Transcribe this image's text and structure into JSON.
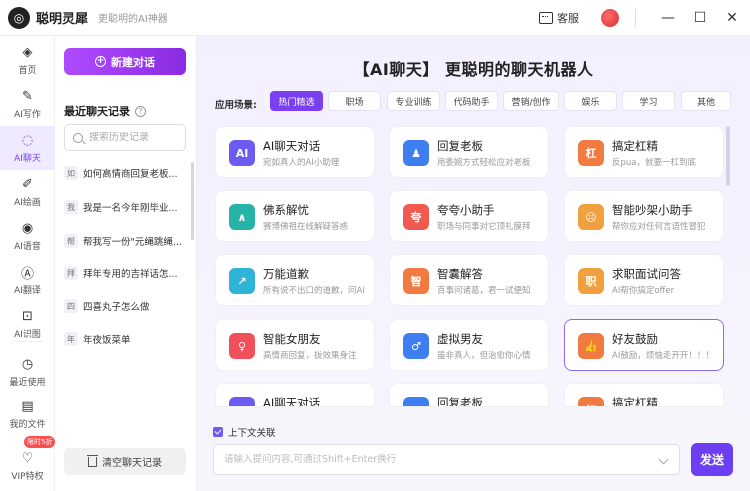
{
  "titlebar": {
    "logo_glyph": "◎",
    "app_name": "聪明灵犀",
    "slogan": "更聪明的AI神器",
    "service_label": "客服",
    "window": {
      "minimize": "—",
      "maximize": "☐",
      "close": "✕"
    }
  },
  "rail": {
    "items": [
      {
        "label": "首页",
        "icon": "◈"
      },
      {
        "label": "AI写作",
        "icon": "✎"
      },
      {
        "label": "AI聊天",
        "icon": "◌"
      },
      {
        "label": "AI绘画",
        "icon": "✐"
      },
      {
        "label": "AI语音",
        "icon": "◉"
      },
      {
        "label": "AI翻译",
        "icon": "Ⓐ"
      },
      {
        "label": "AI识图",
        "icon": "⊡"
      },
      {
        "label": "最近使用",
        "icon": "◷"
      },
      {
        "label": "我的文件",
        "icon": "▤"
      },
      {
        "label": "VIP特权",
        "icon": "♡"
      }
    ],
    "vip_badge": "限时5折"
  },
  "history": {
    "new_chat_label": "新建对话",
    "recent_title": "最近聊天记录",
    "search_placeholder": "搜索历史记录",
    "items": [
      {
        "tag": "如",
        "text": "如何高情商回复老板..."
      },
      {
        "tag": "我",
        "text": "我是一名今年刚毕业..."
      },
      {
        "tag": "帮",
        "text": "帮我写一份\"元绳跳绳..."
      },
      {
        "tag": "拜",
        "text": "拜年专用的吉祥话怎..."
      },
      {
        "tag": "四",
        "text": "四喜丸子怎么做"
      },
      {
        "tag": "年",
        "text": "年夜饭菜单"
      }
    ],
    "clear_label": "清空聊天记录"
  },
  "main": {
    "headline": "【AI聊天】 更聪明的聊天机器人",
    "scene_label": "应用场景:",
    "scenes": [
      "热门精选",
      "职场",
      "专业训练",
      "代码助手",
      "营销/创作",
      "娱乐",
      "学习",
      "其他"
    ],
    "cards": [
      {
        "title": "AI聊天对话",
        "desc": "宛如真人的AI小助理",
        "color": "#6b5bf0",
        "glyph": "AI"
      },
      {
        "title": "回复老板",
        "desc": "用委婉方式轻松应对老板",
        "color": "#3f7ef0",
        "glyph": "♟"
      },
      {
        "title": "搞定杠精",
        "desc": "反pua，就要一杠到底",
        "color": "#f07a3f",
        "glyph": "杠"
      },
      {
        "title": "佛系解忧",
        "desc": "赛博佛祖在线解疑答惑",
        "color": "#27b3a6",
        "glyph": "∧"
      },
      {
        "title": "夸夸小助手",
        "desc": "职场与同事对它顶礼膜拜",
        "color": "#f05a4f",
        "glyph": "夸"
      },
      {
        "title": "智能吵架小助手",
        "desc": "帮你应对任何言语性冒犯",
        "color": "#f0a03f",
        "glyph": "☹"
      },
      {
        "title": "万能道歉",
        "desc": "所有说不出口的道歉，问AI",
        "color": "#2fb4d8",
        "glyph": "↗"
      },
      {
        "title": "智囊解答",
        "desc": "百事问诸葛，君一试便知",
        "color": "#f07a3f",
        "glyph": "智"
      },
      {
        "title": "求职面试问答",
        "desc": "AI帮你搞定offer",
        "color": "#f0a03f",
        "glyph": "职"
      },
      {
        "title": "智能女朋友",
        "desc": "高情商回复，拢效果身注",
        "color": "#f0505a",
        "glyph": "♀"
      },
      {
        "title": "虚拟男友",
        "desc": "虽非真人，但治愈你心情",
        "color": "#3f7ef0",
        "glyph": "♂"
      },
      {
        "title": "好友鼓励",
        "desc": "AI鼓励，烦恼走开开！！！",
        "color": "#f07a3f",
        "glyph": "👍"
      },
      {
        "title": "AI聊天对话",
        "desc": "",
        "color": "#6b5bf0",
        "glyph": "AI"
      },
      {
        "title": "回复老板",
        "desc": "",
        "color": "#3f7ef0",
        "glyph": "♟"
      },
      {
        "title": "搞定杠精",
        "desc": "",
        "color": "#f07a3f",
        "glyph": "杠"
      }
    ],
    "context_label": "上下文关联",
    "input_placeholder": "请输入提问内容,可通过Shift+Enter换行",
    "send_label": "发送"
  }
}
